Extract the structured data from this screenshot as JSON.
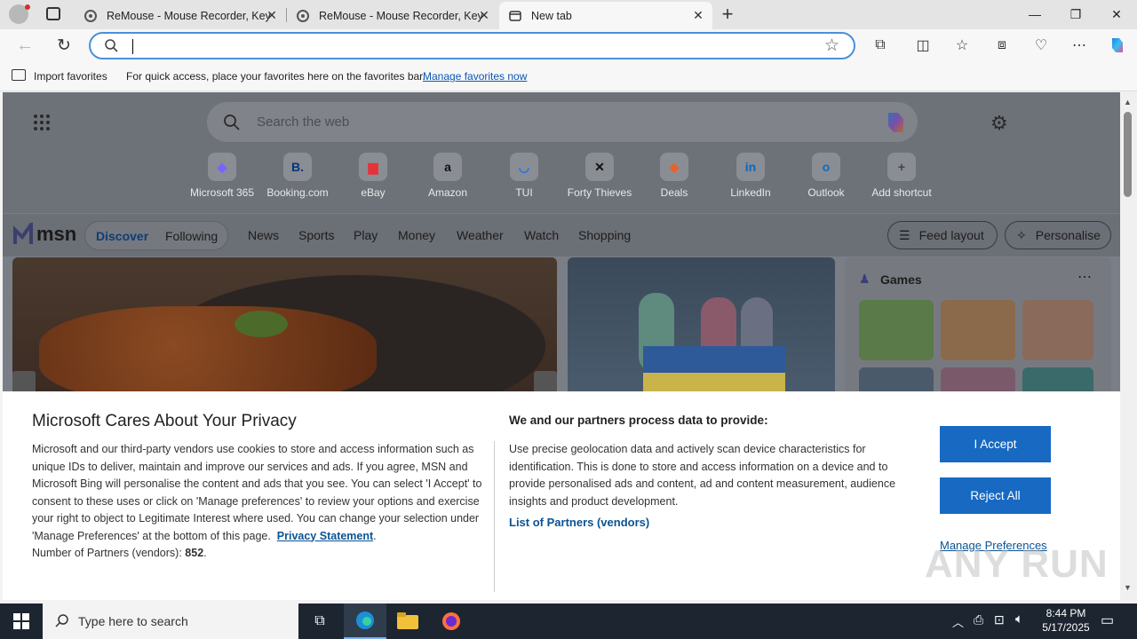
{
  "browser": {
    "tabs": [
      {
        "title": "ReMouse - Mouse Recorder, Keyb"
      },
      {
        "title": "ReMouse - Mouse Recorder, Keyb"
      },
      {
        "title": "New tab"
      }
    ],
    "address_value": "",
    "favorites_bar": {
      "import_label": "Import favorites",
      "hint": "For quick access, place your favorites here on the favorites bar.",
      "manage_link": "Manage favorites now"
    }
  },
  "newtab": {
    "search_placeholder": "Search the web",
    "shortcuts": [
      {
        "label": "Microsoft 365",
        "glyph": "◆",
        "color": "#7b61ff"
      },
      {
        "label": "Booking.com",
        "glyph": "B.",
        "color": "#003580"
      },
      {
        "label": "eBay",
        "glyph": "▆",
        "color": "#e53238"
      },
      {
        "label": "Amazon",
        "glyph": "a",
        "color": "#111111"
      },
      {
        "label": "TUI",
        "glyph": "◡",
        "color": "#1a73e8"
      },
      {
        "label": "Forty Thieves",
        "glyph": "✕",
        "color": "#111111"
      },
      {
        "label": "Deals",
        "glyph": "◆",
        "color": "#e8632a"
      },
      {
        "label": "LinkedIn",
        "glyph": "in",
        "color": "#0a66c2"
      },
      {
        "label": "Outlook",
        "glyph": "o",
        "color": "#0f6cbd"
      },
      {
        "label": "Add shortcut",
        "glyph": "+",
        "color": "#444444"
      }
    ],
    "msn": {
      "logo": "msn",
      "segments": [
        "Discover",
        "Following"
      ],
      "nav": [
        "News",
        "Sports",
        "Play",
        "Money",
        "Weather",
        "Watch",
        "Shopping"
      ],
      "feed_layout": "Feed layout",
      "personalise": "Personalise",
      "games_title": "Games"
    }
  },
  "privacy": {
    "title": "Microsoft Cares About Your Privacy",
    "body": "Microsoft and our third-party vendors use cookies to store and access information such as unique IDs to deliver, maintain and improve our services and ads. If you agree, MSN and Microsoft Bing will personalise the content and ads that you see. You can select 'I Accept' to consent to these uses or click on 'Manage preferences' to review your options and exercise your right to object to Legitimate Interest where used.  You can change your selection under 'Manage Preferences' at the bottom of this page.",
    "privacy_link": "Privacy Statement",
    "partners_label": "Number of Partners (vendors):",
    "partners_count": "852",
    "right_title": "We and our partners process data to provide:",
    "right_body": "Use precise geolocation data and actively scan device characteristics for identification. This is done to store and access information on a device and to provide personalised ads and content, ad and content measurement, audience insights and product development.",
    "partners_link": "List of Partners (vendors)",
    "accept": "I Accept",
    "reject": "Reject All",
    "manage": "Manage Preferences"
  },
  "watermark": "ANY RUN",
  "taskbar": {
    "search_placeholder": "Type here to search",
    "time": "8:44 PM",
    "date": "5/17/2025"
  }
}
